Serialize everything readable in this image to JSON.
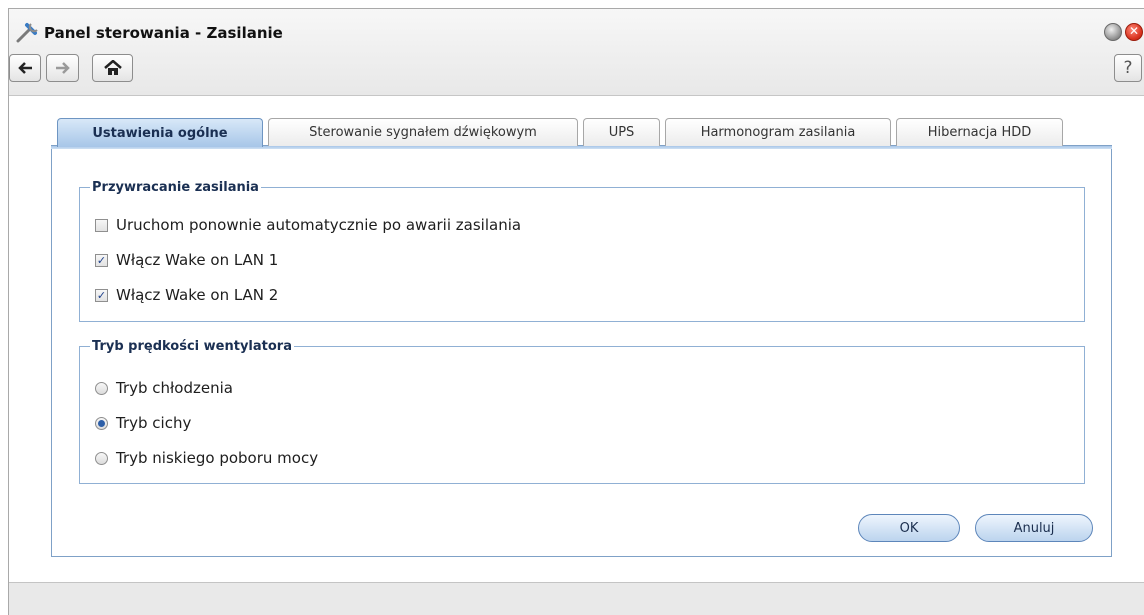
{
  "window": {
    "title": "Panel sterowania - Zasilanie",
    "close_glyph": "✕",
    "help_label": "?"
  },
  "tabs": [
    {
      "label": "Ustawienia ogólne",
      "active": true
    },
    {
      "label": "Sterowanie sygnałem dźwiękowym",
      "active": false
    },
    {
      "label": "UPS",
      "active": false
    },
    {
      "label": "Harmonogram zasilania",
      "active": false
    },
    {
      "label": "Hibernacja HDD",
      "active": false
    }
  ],
  "power_recovery": {
    "legend": "Przywracanie zasilania",
    "options": [
      {
        "label": "Uruchom ponownie automatycznie po awarii zasilania",
        "checked": false
      },
      {
        "label": "Włącz Wake on LAN 1",
        "checked": true
      },
      {
        "label": "Włącz Wake on LAN 2",
        "checked": true
      }
    ]
  },
  "fan_mode": {
    "legend": "Tryb prędkości wentylatora",
    "options": [
      {
        "label": "Tryb chłodzenia",
        "selected": false
      },
      {
        "label": "Tryb cichy",
        "selected": true
      },
      {
        "label": "Tryb niskiego poboru mocy",
        "selected": false
      }
    ]
  },
  "buttons": {
    "ok": "OK",
    "cancel": "Anuluj"
  },
  "check_glyph": "✓",
  "icons": [
    "tools-icon",
    "minimize-icon",
    "close-icon",
    "back-arrow-icon",
    "forward-arrow-icon",
    "home-icon",
    "help-icon"
  ],
  "colors": {
    "accent": "#a7c6e8",
    "border": "#7fa1c7",
    "legend": "#1a2f52"
  }
}
